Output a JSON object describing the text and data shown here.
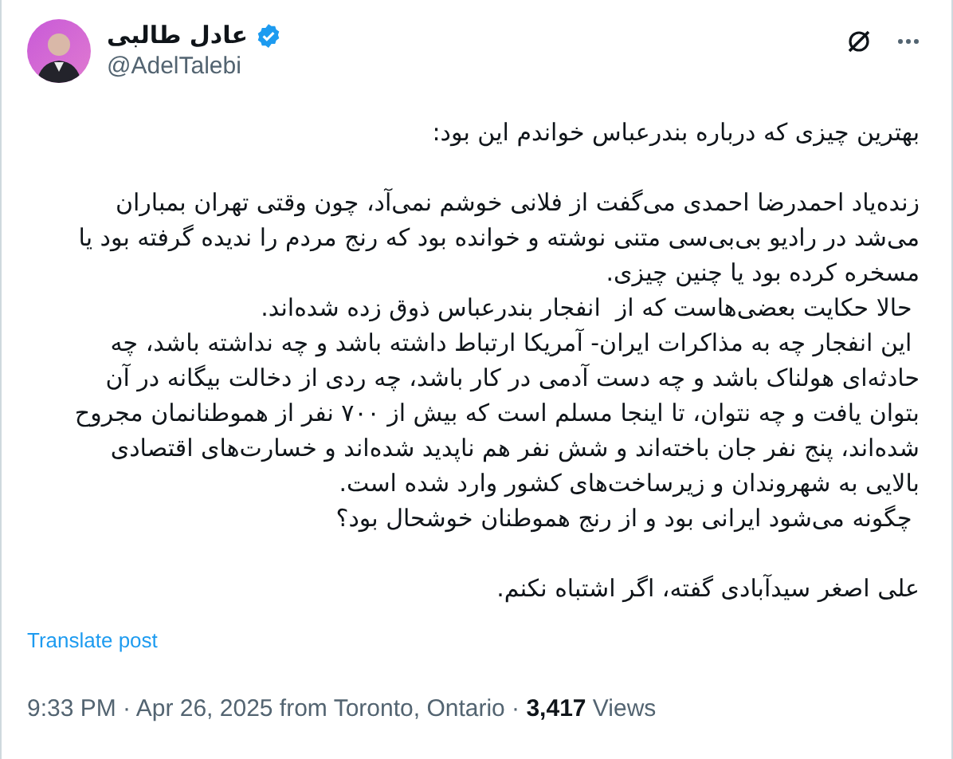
{
  "author": {
    "name": "عادل طالبی",
    "handle": "@AdelTalebi",
    "verified": true
  },
  "body": [
    {
      "lines": [
        "بهترین چیزی که درباره بندرعباس خواندم این بود:"
      ]
    },
    {
      "lines": [
        "زنده‌یاد احمدرضا احمدی می‌گفت از فلانی خوشم نمی‌آد، چون وقتی تهران بمباران",
        "می‌شد در رادیو بی‌بی‌سی متنی نوشته و خوانده بود که رنج مردم را ندیده گرفته بود یا",
        "مسخره کرده بود یا چنین چیزی.",
        " حالا حکایت بعضی‌هاست که از  انفجار بندرعباس ذوق زده شده‌اند.",
        " این انفجار چه به مذاکرات ایران- آمریکا ارتباط داشته باشد و چه نداشته باشد، چه",
        "حادثه‌ای هولناک باشد و چه دست آدمی در کار باشد، چه ردی از دخالت بیگانه در آن",
        "بتوان یافت و چه نتوان، تا اینجا مسلم است که بیش از ۷۰۰ نفر از هموطنانمان مجروح",
        "شده‌اند، پنج نفر جان باخته‌اند و شش نفر هم ناپدید شده‌اند و خسارت‌های اقتصادی",
        "بالایی به شهروندان و زیرساخت‌های کشور وارد شده است.",
        " چگونه می‌شود ایرانی بود و از رنج هموطنان خوشحال بود؟"
      ]
    },
    {
      "lines": [
        "علی اصغر سیدآبادی گفته، اگر اشتباه نکنم."
      ]
    }
  ],
  "translate_link": "Translate post",
  "meta": "9:33 PM · Apr 26, 2025 from Toronto, Ontario · **3,417** Views"
}
